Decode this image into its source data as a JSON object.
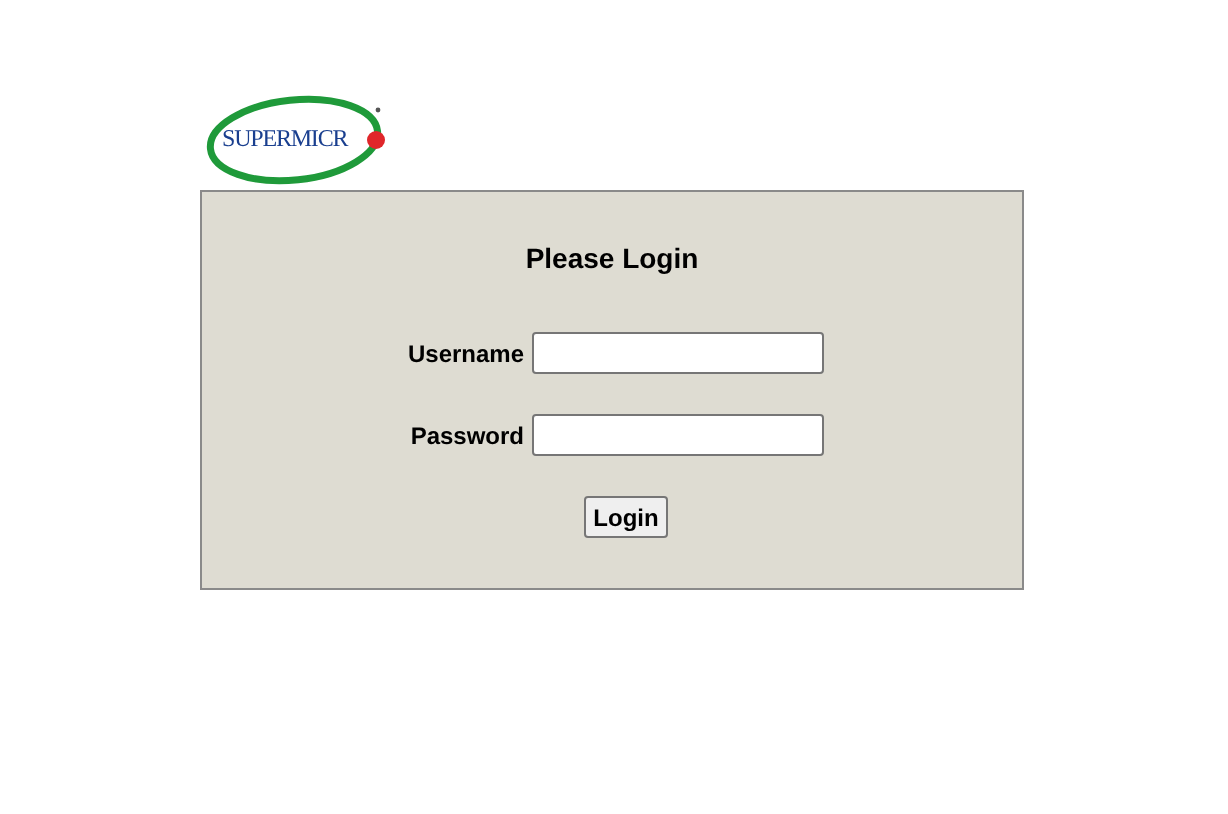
{
  "logo": {
    "text": "SUPERMICR"
  },
  "login_panel": {
    "title": "Please Login",
    "fields": [
      {
        "label": "Username"
      },
      {
        "label": "Password"
      }
    ],
    "button": "Login"
  }
}
